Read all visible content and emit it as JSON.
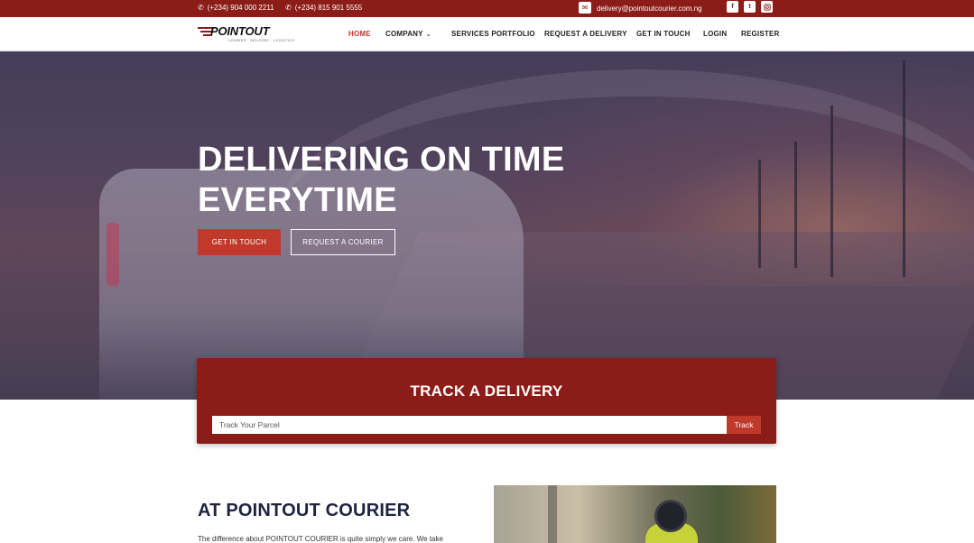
{
  "topbar": {
    "phone1": "(+234) 904 000 2211",
    "phone2": "(+234) 815 901 5555",
    "email": "delivery@pointoutcourier.com.ng",
    "social": [
      "f",
      "t",
      "ig"
    ]
  },
  "logo": {
    "wordmark": "POINTOUT",
    "tagline": "COURIER · DELIVERY · LOGISTICS"
  },
  "nav": {
    "items": [
      {
        "label": "HOME",
        "active": true
      },
      {
        "label": "COMPANY",
        "dropdown": true
      },
      {
        "label": "SERVICES PORTFOLIO"
      },
      {
        "label": "REQUEST A DELIVERY"
      },
      {
        "label": "GET IN TOUCH"
      },
      {
        "label": "LOGIN"
      },
      {
        "label": "REGISTER"
      }
    ]
  },
  "hero": {
    "title_line1": "DELIVERING ON TIME",
    "title_line2": "EVERYTIME",
    "btn_primary": "GET IN TOUCH",
    "btn_secondary": "REQUEST A COURIER"
  },
  "track": {
    "heading": "TRACK A DELIVERY",
    "placeholder": "Track Your Parcel",
    "button": "Track"
  },
  "about": {
    "heading": "AT POINTOUT COURIER",
    "text": "The difference about POINTOUT COURIER is quite simply we care. We take"
  },
  "colors": {
    "brand_dark": "#8c1c17",
    "brand_accent": "#c0392b",
    "heading_navy": "#1f2340"
  }
}
